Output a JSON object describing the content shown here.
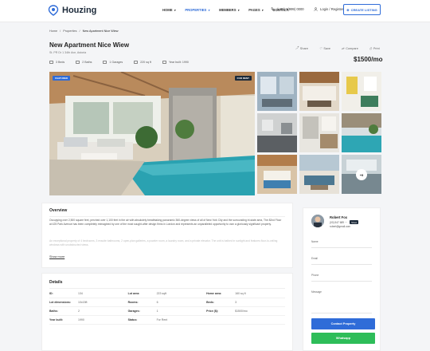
{
  "brand": {
    "name": "Houzing",
    "accent": "#2f6cd8"
  },
  "nav": {
    "items": [
      {
        "label": "HOME",
        "caret": "▾"
      },
      {
        "label": "PROPERTIES",
        "caret": "▾"
      },
      {
        "label": "MEMBERS",
        "caret": "▾"
      },
      {
        "label": "PAGES",
        "caret": "▾"
      },
      {
        "label": "CONTACT",
        "caret": ""
      }
    ],
    "phone": "(+00) 1(999) 0000",
    "login": "Login / Register",
    "create": "CREATE LISTING"
  },
  "breadcrumb": [
    "Home",
    "/",
    "Properties",
    "/",
    "New Apartment Nice Wiew"
  ],
  "property": {
    "title": "New Apartment Nice Wiew",
    "address": "St. PR Dr 1 34th Ave, Astoria",
    "features": [
      "3 Beds",
      "2 Baths",
      "1 Garages",
      "220 sq ft",
      "Year built: 1990"
    ],
    "price": "$1500/mo",
    "actions": [
      "Share",
      "Save",
      "Compare",
      "Print"
    ],
    "badge_featured": "FEATURED",
    "badge_status": "FOR RENT",
    "more_photos": "+9"
  },
  "overview": {
    "heading": "Overview",
    "para1": "Occupying over 2,500 square feet, perched over 1,100 feet in the air with absolutely breathtaking panoramic 360-degree views of all of New York City and the surrounding tri-state area, The 82nd Floor at 425 Park Avenue has been completely reimagined by one of the most sought-after design firms in London and represents an unparalleled opportunity to own a gloriously significant property.",
    "para2": "An exceptional property of 4 bedrooms, 3 ensuite bathrooms, 2 open-plan galleries, a powder room, a laundry room, and a private elevator. The unit is bathed in sunlight and features floor-to-ceiling windows with unobstructed views.",
    "show_more": "Show more"
  },
  "details": {
    "heading": "Details",
    "rows": [
      [
        {
          "k": "ID:",
          "v": "134"
        },
        {
          "k": "Lot area:",
          "v": "223 sqft"
        },
        {
          "k": "Home area:",
          "v": "160 sq ft"
        }
      ],
      [
        {
          "k": "Lot dimensions:",
          "v": "10x15ft"
        },
        {
          "k": "Rooms:",
          "v": "6"
        },
        {
          "k": "Beds:",
          "v": "3"
        }
      ],
      [
        {
          "k": "Baths:",
          "v": "2"
        },
        {
          "k": "Garages:",
          "v": "1"
        },
        {
          "k": "Price ($):",
          "v": "$1500/mo"
        }
      ],
      [
        {
          "k": "Year built:",
          "v": "1990"
        },
        {
          "k": "Status:",
          "v": "For Rent"
        },
        {
          "k": "",
          "v": ""
        }
      ]
    ]
  },
  "agent": {
    "name": "Robert Fox",
    "phone": "(00) 547 689 ···",
    "show": "Show",
    "email": "robert@gmail.com",
    "fields": [
      "Name",
      "Email",
      "Phone",
      "Message"
    ],
    "contact_btn": "Contact Property",
    "whatsapp_btn": "Whatsapp"
  }
}
